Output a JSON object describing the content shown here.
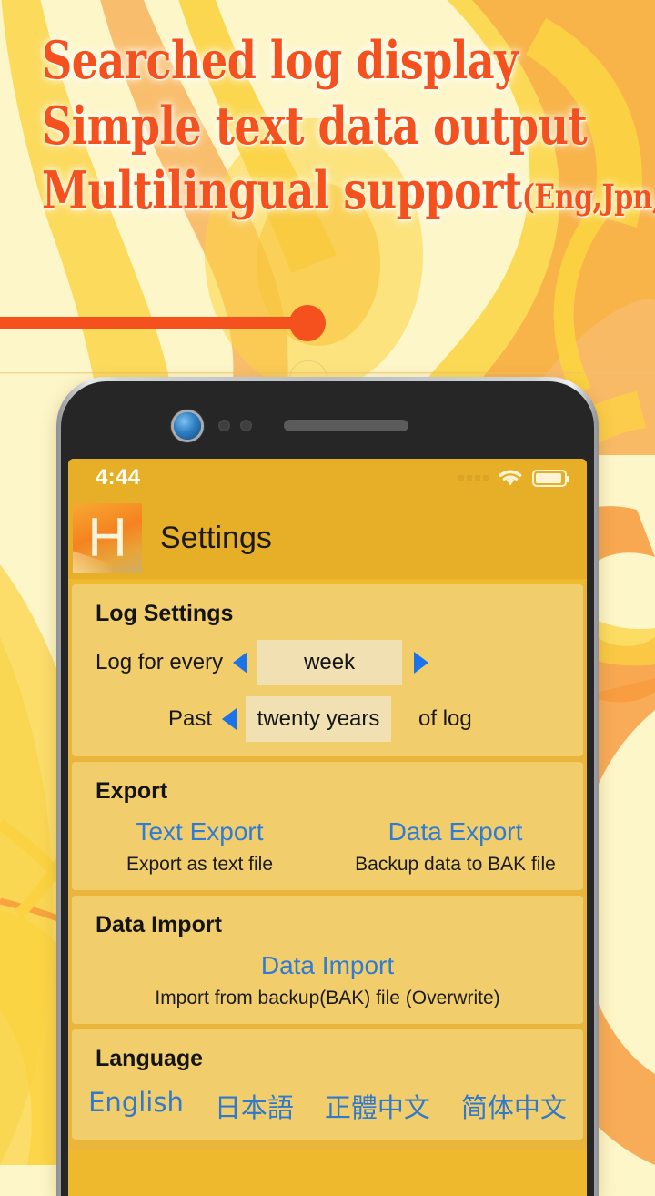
{
  "promo": {
    "headlines": [
      "Searched log display",
      "Simple text data output"
    ],
    "headline_last": "Multilingual support",
    "headline_last_paren": "(Eng,Jpn,Cn)",
    "headline_color": "#f4511e",
    "slider_accent_color": "#f4511e"
  },
  "phone": {
    "status_bar": {
      "time": "4:44",
      "signal_icon": "signal-dots-icon",
      "wifi_icon": "wifi-icon",
      "battery_icon": "battery-icon"
    },
    "nav": {
      "logo_letter": "H",
      "title": "Settings"
    },
    "cards": {
      "log_settings": {
        "title": "Log Settings",
        "row1": {
          "label": "Log for every",
          "value": "week",
          "prev_icon": "triangle-left-icon",
          "next_icon": "triangle-right-icon"
        },
        "row2": {
          "label": "Past",
          "value": "twenty years",
          "suffix": "of log",
          "prev_icon": "triangle-left-icon"
        }
      },
      "export": {
        "title": "Export",
        "actions": [
          {
            "link": "Text Export",
            "desc": "Export as text file"
          },
          {
            "link": "Data Export",
            "desc": "Backup data to BAK file"
          }
        ]
      },
      "data_import": {
        "title": "Data Import",
        "actions": [
          {
            "link": "Data Import",
            "desc": "Import from backup(BAK) file (Overwrite)"
          }
        ]
      },
      "language": {
        "title": "Language",
        "options": [
          {
            "label": "English"
          },
          {
            "label": "日本語"
          },
          {
            "label": "正體中文"
          },
          {
            "label": "简体中文"
          }
        ]
      }
    },
    "theme": {
      "screen_bg": "#e9b53a",
      "navbar_bg": "#e7af28",
      "card_bg": "#f1cd6c",
      "picker_bg": "#f0e0b2",
      "link_color": "#2f7cd6",
      "arrow_color": "#1a73e8"
    }
  }
}
